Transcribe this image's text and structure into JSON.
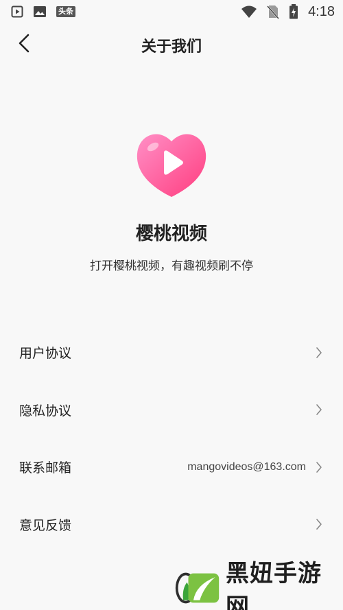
{
  "status_bar": {
    "time": "4:18",
    "left_icons": [
      "play-box-icon",
      "image-icon",
      "toutiao-news-icon"
    ],
    "news_badge_text": "头条",
    "right_icons": [
      "wifi-icon",
      "no-sim-icon",
      "battery-charging-icon"
    ]
  },
  "header": {
    "title": "关于我们",
    "back_icon": "chevron-left-icon"
  },
  "app": {
    "name": "樱桃视频",
    "slogan": "打开樱桃视频，有趣视频刷不停",
    "logo_icon": "heart-play-icon",
    "logo_colors": [
      "#ff8fc6",
      "#ff3d7f"
    ]
  },
  "menu": {
    "items": [
      {
        "label": "用户协议",
        "value": ""
      },
      {
        "label": "隐私协议",
        "value": ""
      },
      {
        "label": "联系邮箱",
        "value": "mangovideos@163.com"
      },
      {
        "label": "意见反馈",
        "value": ""
      }
    ]
  },
  "watermark": {
    "text": "黑妞手游网"
  }
}
